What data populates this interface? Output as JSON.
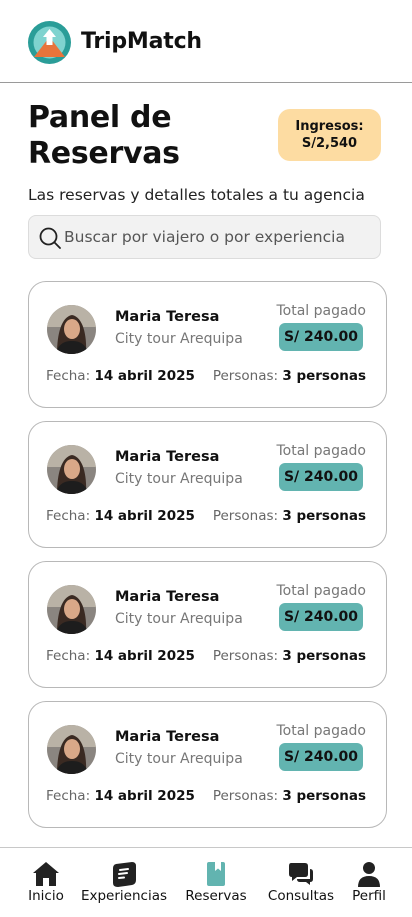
{
  "app": {
    "title": "TripMatch"
  },
  "page": {
    "title": "Panel de Reservas",
    "subtitle": "Las reservas y detalles totales a tu agencia"
  },
  "income": {
    "label": "Ingresos:",
    "value": "S/2,540"
  },
  "search": {
    "placeholder": "Buscar por viajero o por experiencia"
  },
  "reservations": [
    {
      "name": "Maria Teresa",
      "tour": "City tour Arequipa",
      "paid_label": "Total pagado",
      "amount": "S/ 240.00",
      "date_label": "Fecha:",
      "date": "14 abril 2025",
      "people_label": "Personas:",
      "people": "3 personas"
    },
    {
      "name": "Maria Teresa",
      "tour": "City tour Arequipa",
      "paid_label": "Total pagado",
      "amount": "S/ 240.00",
      "date_label": "Fecha:",
      "date": "14 abril 2025",
      "people_label": "Personas:",
      "people": "3 personas"
    },
    {
      "name": "Maria Teresa",
      "tour": "City tour Arequipa",
      "paid_label": "Total pagado",
      "amount": "S/ 240.00",
      "date_label": "Fecha:",
      "date": "14 abril 2025",
      "people_label": "Personas:",
      "people": "3 personas"
    },
    {
      "name": "Maria Teresa",
      "tour": "City tour Arequipa",
      "paid_label": "Total pagado",
      "amount": "S/ 240.00",
      "date_label": "Fecha:",
      "date": "14 abril 2025",
      "people_label": "Personas:",
      "people": "3 personas"
    }
  ],
  "nav": {
    "items": [
      {
        "label": "Inicio",
        "icon": "home-icon"
      },
      {
        "label": "Experiencias",
        "icon": "ticket-icon"
      },
      {
        "label": "Reservas",
        "icon": "book-icon",
        "active": true
      },
      {
        "label": "Consultas",
        "icon": "chat-icon"
      },
      {
        "label": "Perfil",
        "icon": "user-icon"
      }
    ]
  },
  "colors": {
    "accent": "#62b4b0",
    "income_bg": "#fddca2",
    "logo_teal": "#2a9d98",
    "logo_orange": "#e8743b"
  }
}
